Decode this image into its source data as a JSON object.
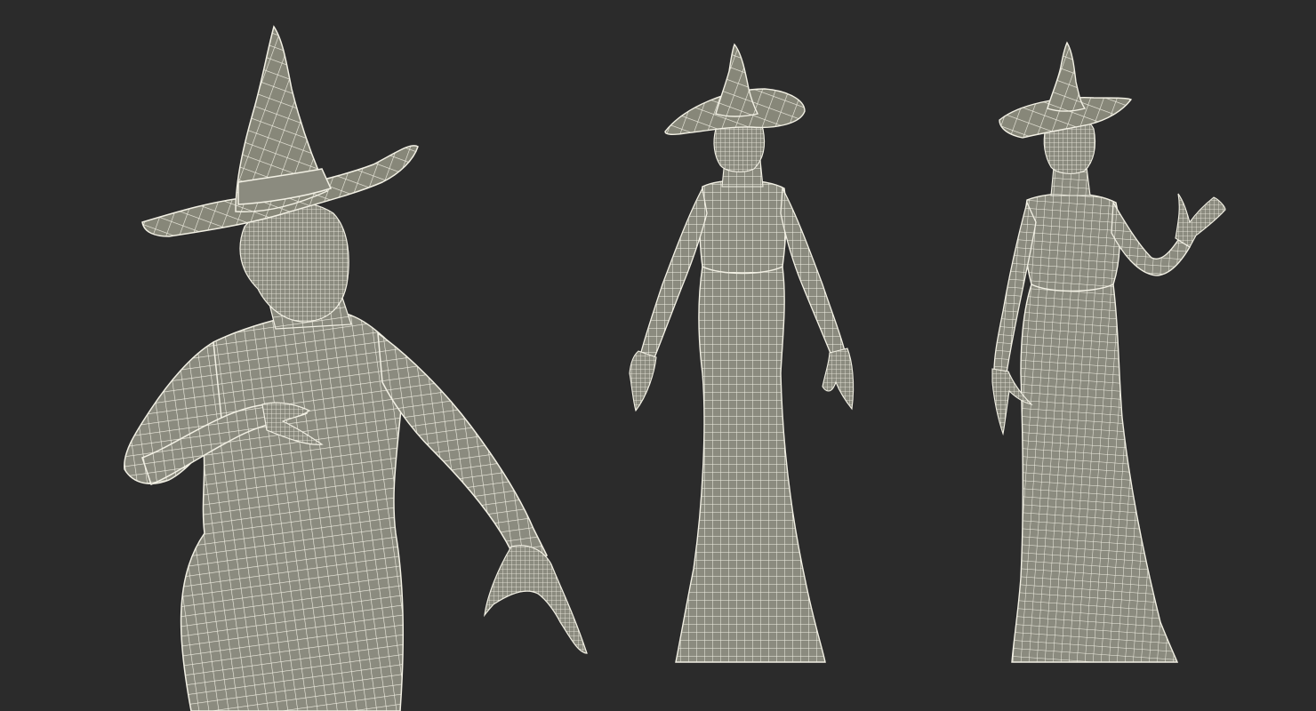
{
  "scene": {
    "background_color": "#2b2b2b",
    "mesh_fill_color": "#8b8b7f",
    "wire_color": "#f2f0e4",
    "figure_count": 3,
    "figures": [
      {
        "pose": "close-up-casting",
        "view": "front-three-quarter"
      },
      {
        "pose": "a-pose",
        "view": "front"
      },
      {
        "pose": "waving",
        "view": "front-three-quarter"
      }
    ]
  }
}
